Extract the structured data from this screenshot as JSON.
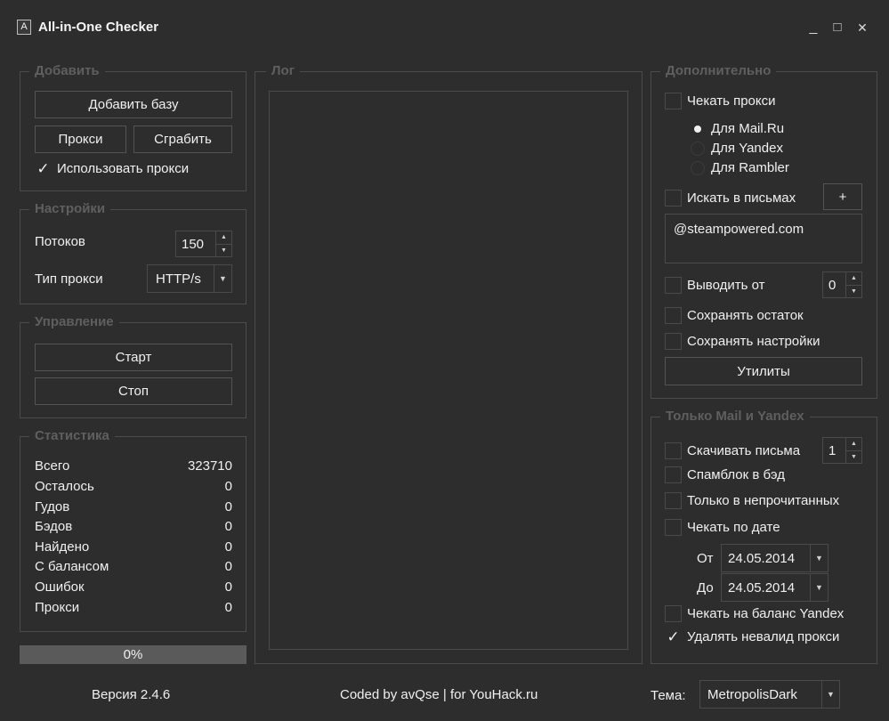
{
  "window": {
    "title": "All-in-One Checker",
    "icon_letter": "A",
    "minimize": "_",
    "maximize": "□",
    "close": "✕"
  },
  "add_group": {
    "legend": "Добавить",
    "add_base_button": "Добавить базу",
    "proxy_button": "Прокси",
    "grab_button": "Сграбить",
    "use_proxy_label": "Использовать прокси",
    "use_proxy_checked": true
  },
  "settings_group": {
    "legend": "Настройки",
    "threads_label": "Потоков",
    "threads_value": "150",
    "proxy_type_label": "Тип прокси",
    "proxy_type_value": "HTTP/s"
  },
  "control_group": {
    "legend": "Управление",
    "start_button": "Старт",
    "stop_button": "Стоп"
  },
  "stats_group": {
    "legend": "Статистика",
    "rows": [
      {
        "label": "Всего",
        "value": "323710"
      },
      {
        "label": "Осталось",
        "value": "0"
      },
      {
        "label": "Гудов",
        "value": "0"
      },
      {
        "label": "Бэдов",
        "value": "0"
      },
      {
        "label": "Найдено",
        "value": "0"
      },
      {
        "label": "С балансом",
        "value": "0"
      },
      {
        "label": "Ошибок",
        "value": "0"
      },
      {
        "label": "Прокси",
        "value": "0"
      }
    ]
  },
  "progress": {
    "text": "0%",
    "fraction": 0.0
  },
  "log_group": {
    "legend": "Лог"
  },
  "extra_group": {
    "legend": "Дополнительно",
    "check_proxy_label": "Чекать прокси",
    "check_proxy_checked": false,
    "radio_options": [
      {
        "label": "Для Mail.Ru",
        "selected": true
      },
      {
        "label": "Для Yandex",
        "selected": false
      },
      {
        "label": "Для Rambler",
        "selected": false
      }
    ],
    "search_mails_label": "Искать в письмах",
    "search_mails_checked": false,
    "add_button": "+",
    "search_text": "@steampowered.com",
    "output_from_label": "Выводить от",
    "output_from_checked": false,
    "output_from_value": "0",
    "save_rest_label": "Сохранять остаток",
    "save_rest_checked": false,
    "save_settings_label": "Сохранять настройки",
    "save_settings_checked": false,
    "utilities_button": "Утилиты"
  },
  "mail_yandex_group": {
    "legend": "Только Mail и Yandex",
    "download_mails_label": "Скачивать письма",
    "download_mails_checked": false,
    "download_mails_value": "1",
    "spamblock_label": "Спамблок в бэд",
    "spamblock_checked": false,
    "unread_only_label": "Только в непрочитанных",
    "unread_only_checked": false,
    "check_by_date_label": "Чекать по дате",
    "check_by_date_checked": false,
    "from_label": "От",
    "from_date": "24.05.2014",
    "to_label": "До",
    "to_date": "24.05.2014",
    "yandex_balance_label": "Чекать на баланс Yandex",
    "yandex_balance_checked": false,
    "remove_invalid_proxy_label": "Удалять невалид прокси",
    "remove_invalid_proxy_checked": true
  },
  "footer": {
    "version": "Версия 2.4.6",
    "credits": "Coded by avQse | for YouHack.ru",
    "theme_label": "Тема:",
    "theme_value": "MetropolisDark"
  },
  "colors": {
    "background": "#2d2d2d",
    "border": "#4c4c4c",
    "legend": "#5f5f5f",
    "text": "#f0f0f0",
    "progress": "#5a5a5a"
  }
}
